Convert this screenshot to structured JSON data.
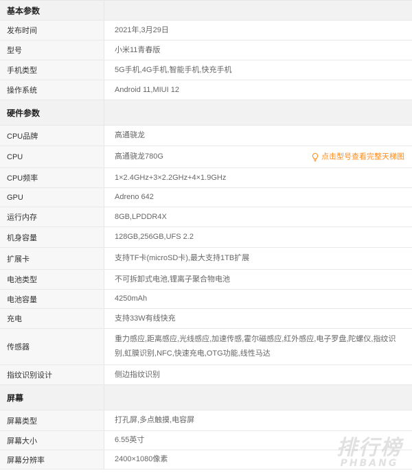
{
  "sections": [
    {
      "title": "基本参数",
      "rows": [
        {
          "label": "发布时间",
          "value": "2021年,3月29日"
        },
        {
          "label": "型号",
          "value": "小米11青春版"
        },
        {
          "label": "手机类型",
          "value": "5G手机,4G手机,智能手机,快充手机"
        },
        {
          "label": "操作系统",
          "value": "Android 11,MIUI 12"
        }
      ]
    },
    {
      "title": "硬件参数",
      "rows": [
        {
          "label": "CPU品牌",
          "value": "高通骁龙"
        },
        {
          "label": "CPU",
          "value": "高通骁龙780G",
          "tip": "点击型号查看完整天梯图"
        },
        {
          "label": "CPU频率",
          "value": "1×2.4GHz+3×2.2GHz+4×1.9GHz"
        },
        {
          "label": "GPU",
          "value": "Adreno 642"
        },
        {
          "label": "运行内存",
          "value": "8GB,LPDDR4X"
        },
        {
          "label": "机身容量",
          "value": "128GB,256GB,UFS 2.2"
        },
        {
          "label": "扩展卡",
          "value": "支持TF卡(microSD卡),最大支持1TB扩展"
        },
        {
          "label": "电池类型",
          "value": "不可拆卸式电池,锂离子聚合物电池"
        },
        {
          "label": "电池容量",
          "value": "4250mAh"
        },
        {
          "label": "充电",
          "value": "支持33W有线快充"
        },
        {
          "label": "传感器",
          "value": "重力感应,距离感应,光线感应,加速传感,霍尔磁感应,红外感应,电子罗盘,陀螺仪,指纹识别,虹膜识别,NFC,快速充电,OTG功能,线性马达"
        },
        {
          "label": "指纹识别设计",
          "value": "侧边指纹识别"
        }
      ]
    },
    {
      "title": "屏幕",
      "rows": [
        {
          "label": "屏幕类型",
          "value": "打孔屏,多点触摸,电容屏"
        },
        {
          "label": "屏幕大小",
          "value": "6.55英寸"
        },
        {
          "label": "屏幕分辨率",
          "value": "2400×1080像素"
        }
      ]
    }
  ],
  "watermark": {
    "main": "排行榜",
    "sub": "PHBANG"
  },
  "colors": {
    "tip": "#ff8c1a",
    "section_bg": "#f2f2f2",
    "label_bg": "#f7f7f7",
    "border": "#e8e8e8"
  },
  "icons": {
    "tip_icon": "lightbulb-icon"
  }
}
